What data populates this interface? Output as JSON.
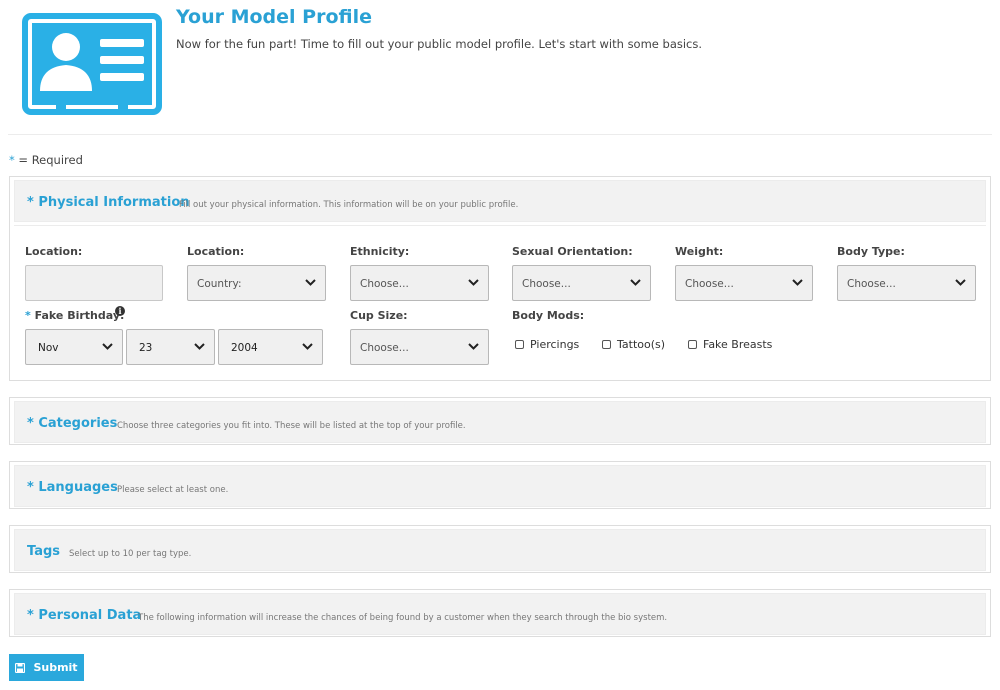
{
  "header": {
    "title": "Your Model Profile",
    "intro": "Now for the fun part! Time to fill out your public model profile. Let's start with some basics.",
    "icon": "profile-card-icon",
    "accent_color": "#2aa1d4"
  },
  "required_note": {
    "star": "*",
    "text": "= Required"
  },
  "physical": {
    "title": "* Physical Information",
    "description": "Fill out your physical information. This information will be on your public profile.",
    "location_city_label": "Location:",
    "location_city_value": "",
    "location_country_label": "Location:",
    "location_country_value": "Country:",
    "ethnicity_label": "Ethnicity:",
    "ethnicity_value": "Choose...",
    "orientation_label": "Sexual Orientation:",
    "orientation_value": "Choose...",
    "weight_label": "Weight:",
    "weight_value": "Choose...",
    "body_type_label": "Body Type:",
    "body_type_value": "Choose...",
    "birthday_star": "*",
    "birthday_label": "Fake Birthday:",
    "birthday_month": "Nov",
    "birthday_day": "23",
    "birthday_year": "2004",
    "cup_size_label": "Cup Size:",
    "cup_size_value": "Choose...",
    "body_mods_label": "Body Mods:",
    "body_mods": [
      {
        "label": "Piercings",
        "checked": false
      },
      {
        "label": "Tattoo(s)",
        "checked": false
      },
      {
        "label": "Fake Breasts",
        "checked": false
      }
    ]
  },
  "categories": {
    "title": "* Categories",
    "description": "Choose three categories you fit into. These will be listed at the top of your profile."
  },
  "languages": {
    "title": "* Languages",
    "description": "Please select at least one."
  },
  "tags": {
    "title": "Tags",
    "description": "Select up to 10 per tag type."
  },
  "personal": {
    "title": "* Personal Data",
    "description": "The following information will increase the chances of being found by a customer when they search through the bio system."
  },
  "submit": {
    "label": "Submit",
    "icon": "save-icon",
    "color": "#2aa8dc"
  }
}
